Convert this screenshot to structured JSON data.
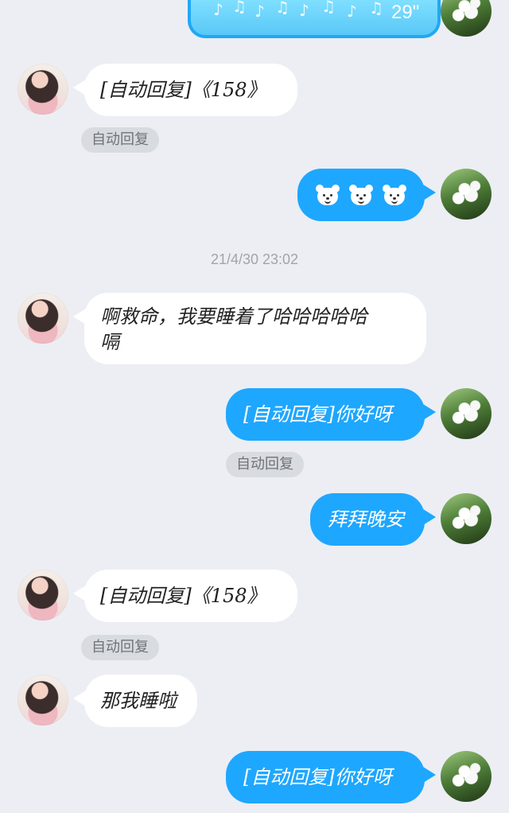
{
  "voice": {
    "duration": "29\""
  },
  "messages": {
    "auto_reply_158_1": "[自动回复]《158》",
    "auto_label": "自动回复",
    "timestamp": "21/4/30 23:02",
    "long_message_line1": "啊救命，我要睡着了哈哈哈哈哈",
    "long_message_line2": "嗝",
    "auto_reply_hello": "[自动回复]你好呀",
    "bye": "拜拜晚安",
    "auto_reply_158_2": "[自动回复]《158》",
    "sleep": "那我睡啦",
    "auto_reply_hello_2": "[自动回复]你好呀"
  },
  "colors": {
    "background": "#eceef3",
    "left_bubble": "#ffffff",
    "right_bubble": "#1ea7ff",
    "pill_bg": "#d8dbe0",
    "pill_text": "#6f7379",
    "timestamp": "#a1a4aa"
  },
  "icons": {
    "bear_emoji": "bear-emoji-icon",
    "voice_wave": "voice-wave-icon"
  }
}
